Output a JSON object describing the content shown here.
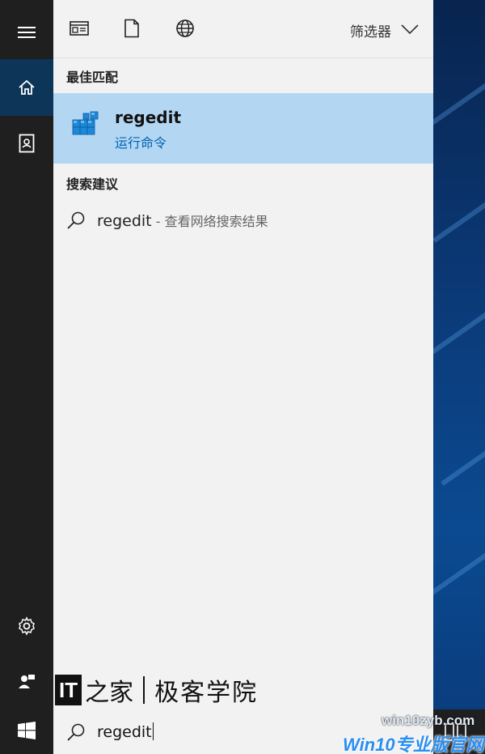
{
  "toolbar": {
    "icons": [
      "apps-icon",
      "documents-icon",
      "web-icon"
    ],
    "filter_label": "筛选器"
  },
  "sections": {
    "best_match_title": "最佳匹配",
    "suggestions_title": "搜索建议"
  },
  "best_match": {
    "title": "regedit",
    "subtitle": "运行命令",
    "icon": "registry-editor-icon"
  },
  "suggestion": {
    "query": "regedit",
    "hint": " - 查看网络搜索结果"
  },
  "search_box": {
    "value": "regedit"
  },
  "rail": {
    "items": [
      "menu-icon",
      "home-icon",
      "notebook-icon",
      "settings-icon",
      "feedback-icon"
    ]
  },
  "watermarks": {
    "ithome_logo": "IT",
    "ithome_zh": "之家",
    "ithome_name": "极客学院",
    "url": "win10zyb.com",
    "brand": "Win10专业版官网"
  },
  "colors": {
    "accent": "#0063b1",
    "selected_bg": "#b3d7f3",
    "rail_bg": "#1f1f1f",
    "rail_active": "#0c3557"
  }
}
